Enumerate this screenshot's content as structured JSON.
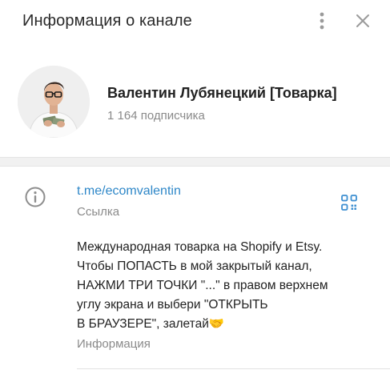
{
  "header": {
    "title": "Информация о канале",
    "menu_icon": "more-vertical-icon",
    "close_icon": "close-icon"
  },
  "profile": {
    "name": "Валентин Лубянецкий [Товарка]",
    "subscribers": "1 164 подписчика"
  },
  "info": {
    "link": "t.me/ecomvalentin",
    "link_label": "Ссылка",
    "description": "Международная товарка на Shopify и Etsy.\nЧтобы ПОПАСТЬ в мой закрытый канал,\nНАЖМИ ТРИ ТОЧКИ \"...\" в правом верхнем\nуглу экрана и выбери \"ОТКРЫТЬ\nВ БРАУЗЕРЕ\", залетай🤝",
    "description_label": "Информация"
  },
  "colors": {
    "link": "#2e87c8",
    "secondary_text": "#8a8a8a",
    "icon": "#999999",
    "qr_icon": "#3d8fd1"
  }
}
